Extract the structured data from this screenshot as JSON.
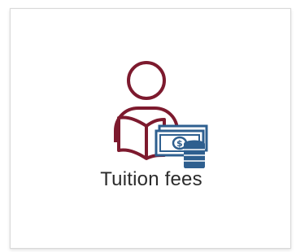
{
  "tile": {
    "label": "Tuition fees",
    "icon": "student-book-money-icon"
  },
  "colors": {
    "person": "#7d1a2e",
    "money": "#2e5f8f",
    "label": "#2b2b2b",
    "border": "#d9d9d9",
    "background": "#ffffff"
  }
}
